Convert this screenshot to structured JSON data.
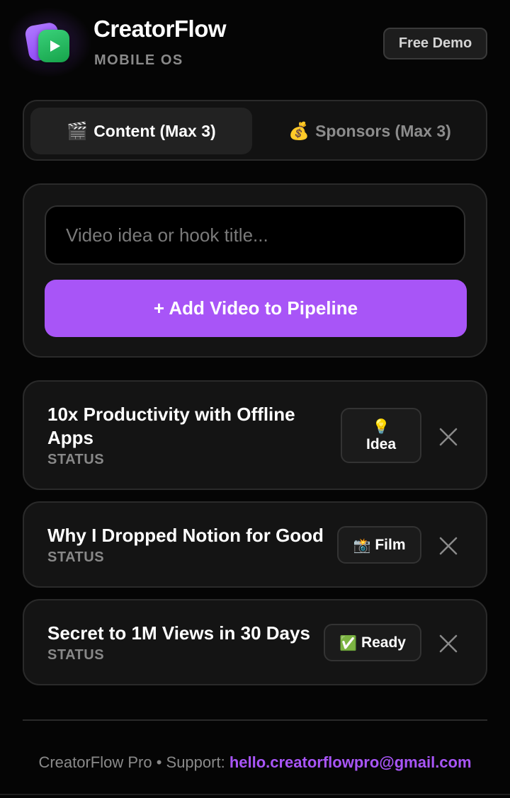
{
  "header": {
    "title": "CreatorFlow",
    "subtitle": "MOBILE OS",
    "demo_label": "Free Demo",
    "logo_icon": "play-icon"
  },
  "tabs": [
    {
      "icon": "🎬",
      "label": "Content (Max 3)",
      "active": true
    },
    {
      "icon": "💰",
      "label": "Sponsors (Max 3)",
      "active": false
    }
  ],
  "form": {
    "input_value": "",
    "input_placeholder": "Video idea or hook title...",
    "add_label": "+ Add Video to Pipeline"
  },
  "videos": [
    {
      "title": "10x Productivity with Offline Apps",
      "status_label": "STATUS",
      "status_icon": "💡",
      "status_value": "Idea"
    },
    {
      "title": "Why I Dropped Notion for Good",
      "status_label": "STATUS",
      "status_icon": "📸",
      "status_value": "Film"
    },
    {
      "title": "Secret to 1M Views in 30 Days",
      "status_label": "STATUS",
      "status_icon": "✅",
      "status_value": "Ready"
    }
  ],
  "footer": {
    "prefix": "CreatorFlow Pro • Support: ",
    "email": "hello.creatorflowpro@gmail.com"
  },
  "colors": {
    "accent": "#a855f7",
    "background": "#050505",
    "card": "#141414",
    "logo_green": "#22c55e"
  }
}
